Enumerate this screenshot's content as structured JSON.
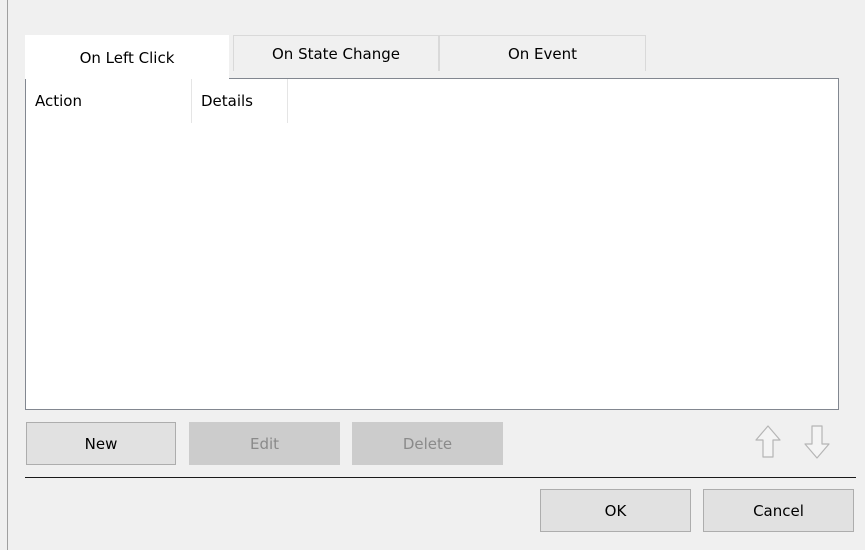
{
  "tabs": [
    {
      "label": "On Left Click",
      "active": true
    },
    {
      "label": "On State Change",
      "active": false
    },
    {
      "label": "On Event",
      "active": false
    }
  ],
  "list": {
    "columns": [
      "Action",
      "Details"
    ],
    "rows": []
  },
  "buttons": {
    "new_label": "New",
    "edit_label": "Edit",
    "delete_label": "Delete",
    "ok_label": "OK",
    "cancel_label": "Cancel"
  },
  "icons": {
    "move_up": "arrow-up-icon",
    "move_down": "arrow-down-icon"
  },
  "colors": {
    "window_bg": "#f0f0f0",
    "disabled_button_bg": "#cccccc",
    "disabled_text": "#8a8a8a",
    "button_bg": "#e1e1e1"
  }
}
